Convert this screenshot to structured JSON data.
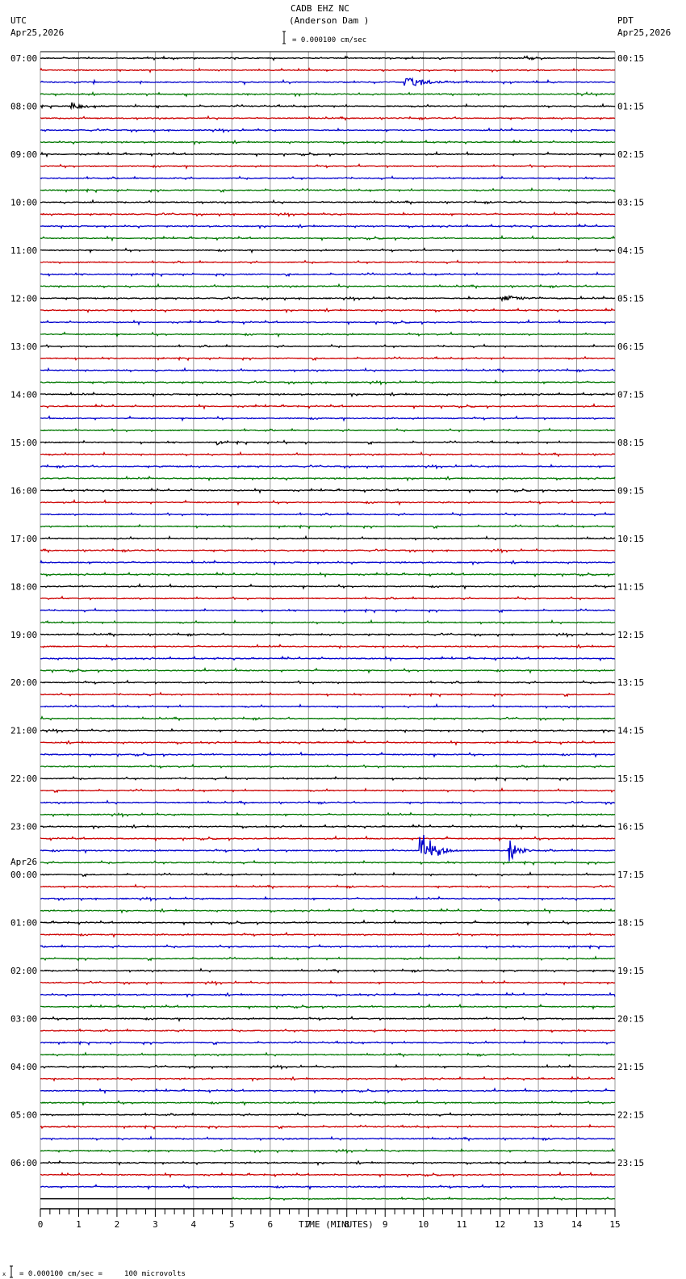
{
  "header": {
    "title": "CADB EHZ NC",
    "subtitle": "(Anderson Dam )",
    "scale_label": "= 0.000100 cm/sec",
    "left_tz": "UTC",
    "left_date": "Apr25,2026",
    "right_tz": "PDT",
    "right_date": "Apr25,2026",
    "day_change_label": "Apr26"
  },
  "footer": {
    "scale_note": "= 0.000100 cm/sec =     100 microvolts",
    "mark": "x"
  },
  "chart_data": {
    "type": "line",
    "title": "CADB EHZ NC (Anderson Dam )",
    "xlabel": "TIME (MINUTES)",
    "xlim": [
      0,
      15
    ],
    "x_ticks": [
      "0",
      "1",
      "2",
      "3",
      "4",
      "5",
      "6",
      "7",
      "8",
      "9",
      "10",
      "11",
      "12",
      "13",
      "14",
      "15"
    ],
    "traces_per_hour": 4,
    "trace_colors": [
      "#000000",
      "#cc0000",
      "#0000cc",
      "#007700"
    ],
    "utc_hour_labels": [
      "07:00",
      "08:00",
      "09:00",
      "10:00",
      "11:00",
      "12:00",
      "13:00",
      "14:00",
      "15:00",
      "16:00",
      "17:00",
      "18:00",
      "19:00",
      "20:00",
      "21:00",
      "22:00",
      "23:00",
      "00:00",
      "01:00",
      "02:00",
      "03:00",
      "04:00",
      "05:00",
      "06:00"
    ],
    "pdt_hour_labels": [
      "00:15",
      "01:15",
      "02:15",
      "03:15",
      "04:15",
      "05:15",
      "06:15",
      "07:15",
      "08:15",
      "09:15",
      "10:15",
      "11:15",
      "12:15",
      "13:15",
      "14:15",
      "15:15",
      "16:15",
      "17:15",
      "18:15",
      "19:15",
      "20:15",
      "21:15",
      "22:15",
      "23:15"
    ],
    "events": [
      {
        "trace": 2,
        "start_min": 9.5,
        "end_min": 12.0,
        "amplitude": 0.4
      },
      {
        "trace": 4,
        "start_min": 0.8,
        "end_min": 2.0,
        "amplitude": 0.35
      },
      {
        "trace": 20,
        "start_min": 12.0,
        "end_min": 14.0,
        "amplitude": 0.3
      },
      {
        "trace": 32,
        "start_min": 4.6,
        "end_min": 5.0,
        "amplitude": 0.3
      },
      {
        "trace": 32,
        "start_min": 6.35,
        "end_min": 6.5,
        "amplitude": 0.7
      },
      {
        "trace": 66,
        "start_min": 9.9,
        "end_min": 11.0,
        "amplitude": 2.5
      },
      {
        "trace": 66,
        "start_min": 12.2,
        "end_min": 13.0,
        "amplitude": 1.4
      }
    ],
    "last_trace_data_start_min": 5.0,
    "grid": true
  }
}
